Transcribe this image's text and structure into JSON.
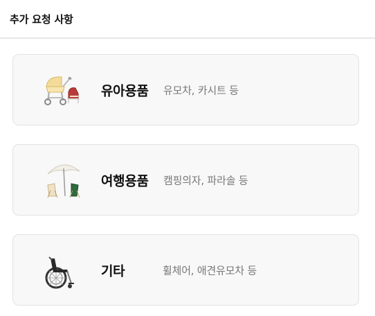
{
  "header": {
    "title": "추가 요청 사항"
  },
  "options": [
    {
      "title": "유아용품",
      "description": "유모차, 카시트 등",
      "icon": "baby-stroller-icon"
    },
    {
      "title": "여행용품",
      "description": "캠핑의자, 파라솔 등",
      "icon": "parasol-chairs-icon"
    },
    {
      "title": "기타",
      "description": "휠체어, 애견유모차 등",
      "icon": "wheelchair-icon"
    }
  ]
}
